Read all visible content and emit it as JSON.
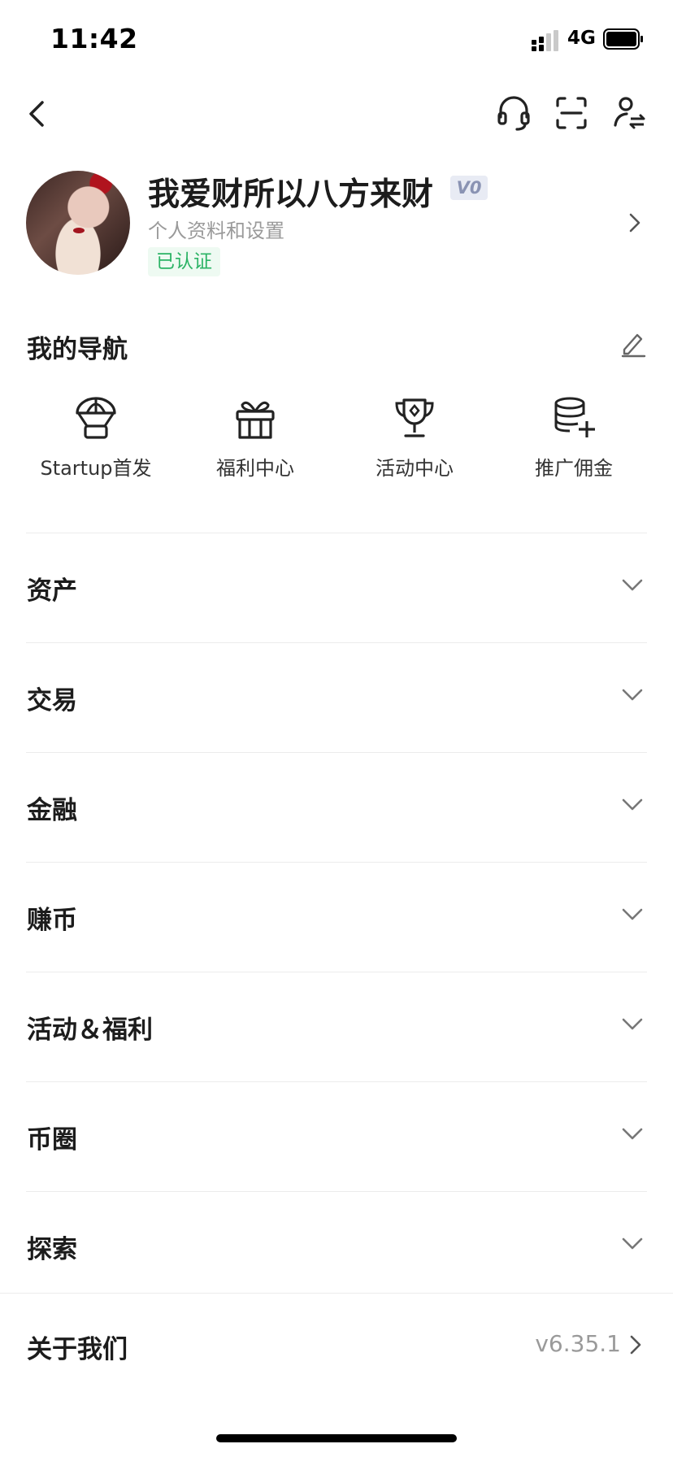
{
  "status_bar": {
    "time": "11:42",
    "network": "4G"
  },
  "header": {
    "icons": [
      "back-icon",
      "headset-icon",
      "scan-icon",
      "switch-account-icon"
    ]
  },
  "profile": {
    "username": "我爱财所以八方来财",
    "vip_level": "V0",
    "subtitle": "个人资料和设置",
    "verified": "已认证"
  },
  "my_nav": {
    "title": "我的导航",
    "items": [
      {
        "label": "Startup首发",
        "icon": "parachute-icon"
      },
      {
        "label": "福利中心",
        "icon": "gift-icon"
      },
      {
        "label": "活动中心",
        "icon": "trophy-icon"
      },
      {
        "label": "推广佣金",
        "icon": "coins-plus-icon"
      }
    ]
  },
  "sections": [
    {
      "label": "资产"
    },
    {
      "label": "交易"
    },
    {
      "label": "金融"
    },
    {
      "label": "赚币"
    },
    {
      "label": "活动＆福利"
    },
    {
      "label": "币圈"
    },
    {
      "label": "探索"
    }
  ],
  "about": {
    "label": "关于我们",
    "version": "v6.35.1"
  },
  "colors": {
    "accent_green": "#2bb365",
    "text_primary": "#1c1c1c",
    "text_secondary": "#9a9a9a"
  }
}
